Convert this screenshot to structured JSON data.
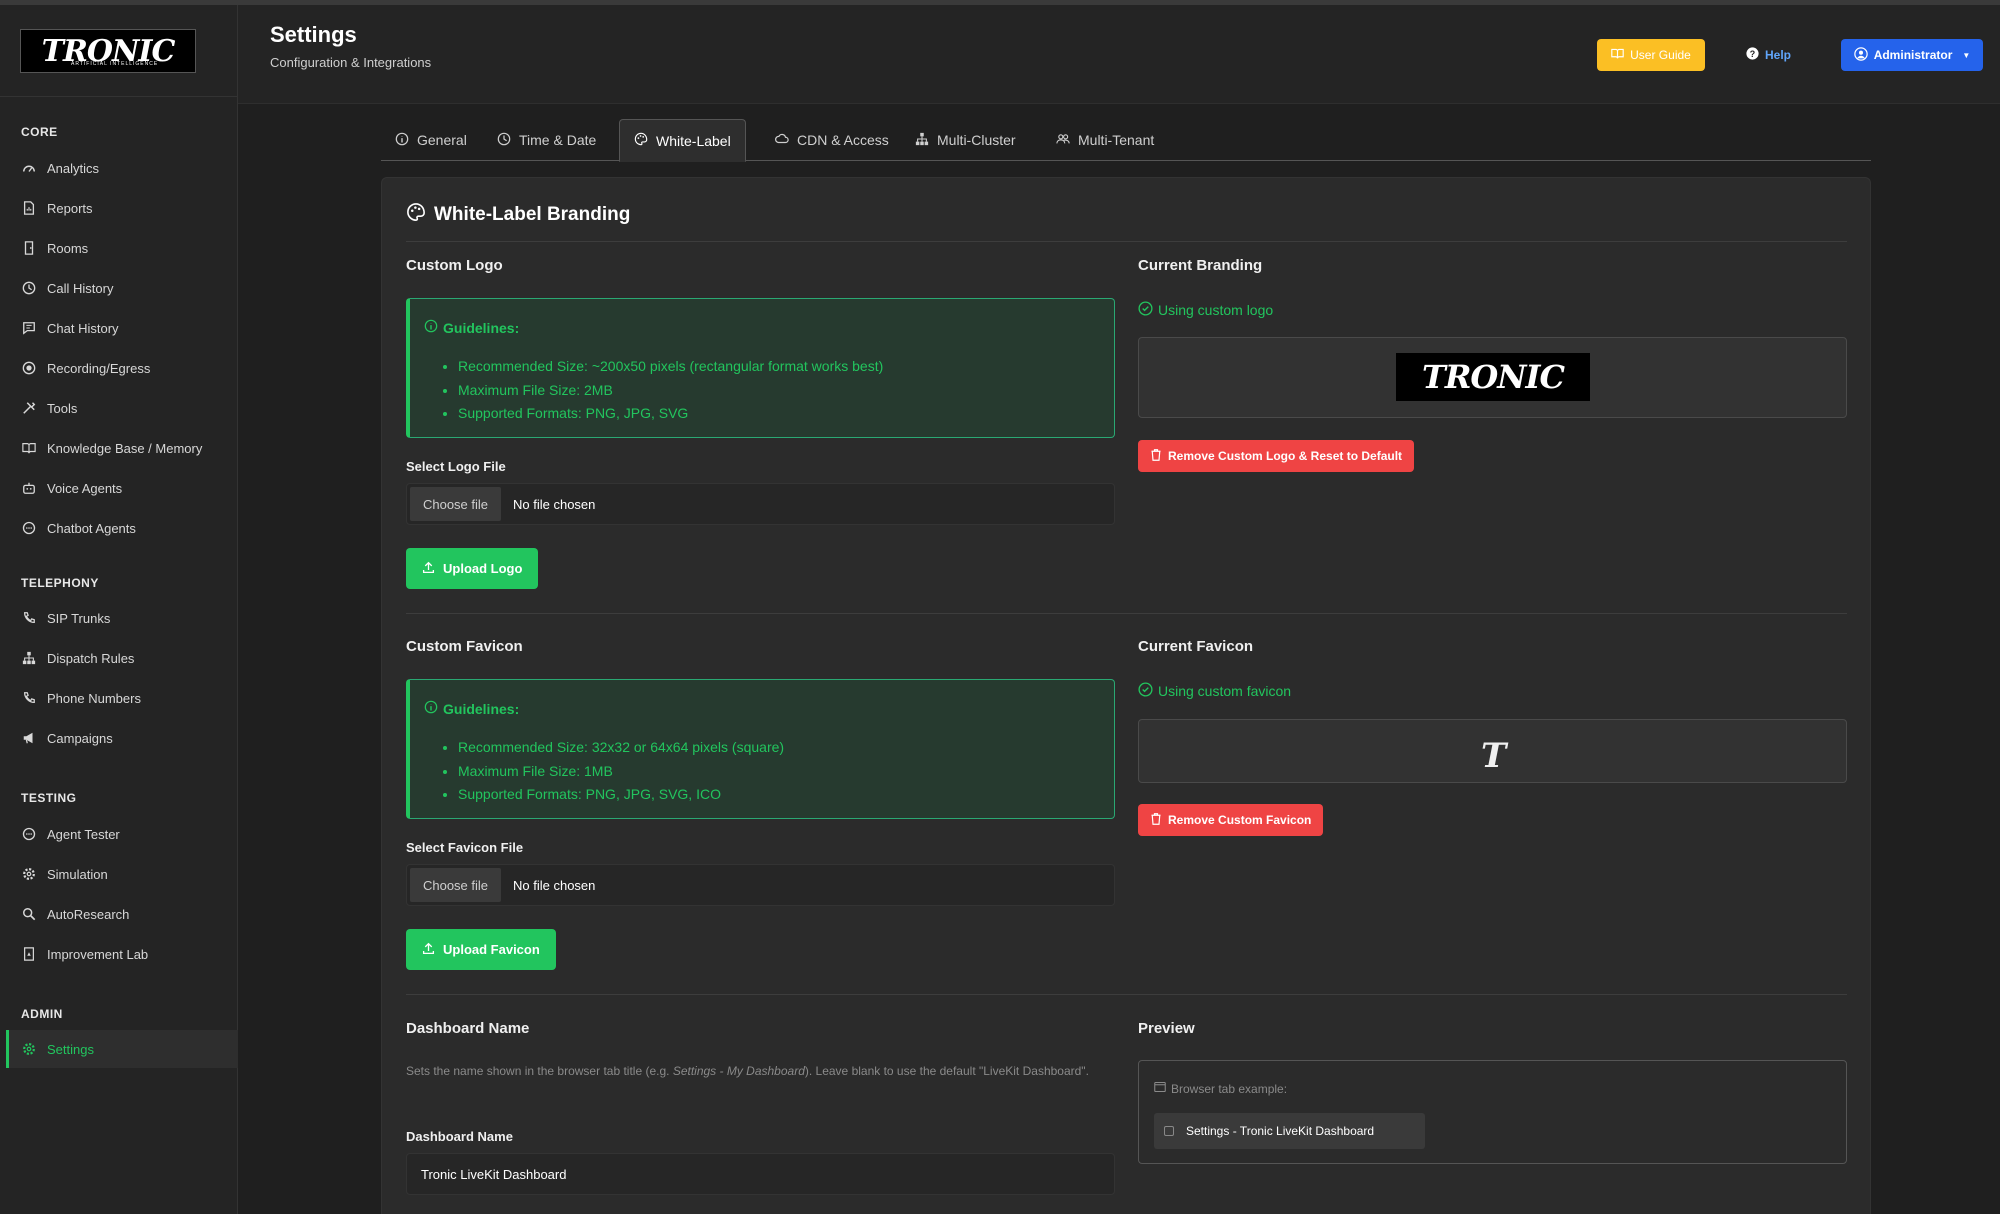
{
  "sidebar": {
    "logo": {
      "text": "TRONIC",
      "sub": "ARTIFICIAL INTELLIGENCE"
    },
    "sections": [
      {
        "label": "CORE",
        "items": [
          {
            "label": "Analytics",
            "icon": "gauge-icon"
          },
          {
            "label": "Reports",
            "icon": "report-icon"
          },
          {
            "label": "Rooms",
            "icon": "door-icon"
          },
          {
            "label": "Call History",
            "icon": "clock-icon"
          },
          {
            "label": "Chat History",
            "icon": "chat-icon"
          },
          {
            "label": "Recording/Egress",
            "icon": "record-icon"
          },
          {
            "label": "Tools",
            "icon": "tools-icon"
          },
          {
            "label": "Knowledge Base / Memory",
            "icon": "book-icon"
          },
          {
            "label": "Voice Agents",
            "icon": "robot-icon"
          },
          {
            "label": "Chatbot Agents",
            "icon": "chatbot-icon"
          }
        ]
      },
      {
        "label": "TELEPHONY",
        "items": [
          {
            "label": "SIP Trunks",
            "icon": "phone-icon"
          },
          {
            "label": "Dispatch Rules",
            "icon": "sitemap-icon"
          },
          {
            "label": "Phone Numbers",
            "icon": "phone-icon"
          },
          {
            "label": "Campaigns",
            "icon": "megaphone-icon"
          }
        ]
      },
      {
        "label": "TESTING",
        "items": [
          {
            "label": "Agent Tester",
            "icon": "chat-icon"
          },
          {
            "label": "Simulation",
            "icon": "gear-icon"
          },
          {
            "label": "AutoResearch",
            "icon": "search-icon"
          },
          {
            "label": "Improvement Lab",
            "icon": "flask-icon"
          }
        ]
      },
      {
        "label": "ADMIN",
        "items": [
          {
            "label": "Settings",
            "icon": "gear-icon",
            "active": true
          }
        ]
      }
    ]
  },
  "header": {
    "title": "Settings",
    "subtitle": "Configuration & Integrations",
    "user_guide": "User Guide",
    "help": "Help",
    "admin": "Administrator"
  },
  "tabs": [
    {
      "label": "General",
      "icon": "info-icon"
    },
    {
      "label": "Time & Date",
      "icon": "clock-icon"
    },
    {
      "label": "White-Label",
      "icon": "palette-icon",
      "active": true
    },
    {
      "label": "CDN & Access",
      "icon": "cloud-icon"
    },
    {
      "label": "Multi-Cluster",
      "icon": "sitemap-icon"
    },
    {
      "label": "Multi-Tenant",
      "icon": "users-icon"
    }
  ],
  "card": {
    "title": "White-Label Branding",
    "logo": {
      "section_title": "Custom Logo",
      "guidelines_title": "Guidelines:",
      "guidelines": [
        "Recommended Size: ~200x50 pixels (rectangular format works best)",
        "Maximum File Size: 2MB",
        "Supported Formats: PNG, JPG, SVG"
      ],
      "file_label": "Select Logo File",
      "choose_label": "Choose file",
      "no_file": "No file chosen",
      "upload_label": "Upload Logo",
      "current_title": "Current Branding",
      "status": "Using custom logo",
      "remove_label": "Remove Custom Logo & Reset to Default"
    },
    "favicon": {
      "section_title": "Custom Favicon",
      "guidelines_title": "Guidelines:",
      "guidelines": [
        "Recommended Size: 32x32 or 64x64 pixels (square)",
        "Maximum File Size: 1MB",
        "Supported Formats: PNG, JPG, SVG, ICO"
      ],
      "file_label": "Select Favicon File",
      "choose_label": "Choose file",
      "no_file": "No file chosen",
      "upload_label": "Upload Favicon",
      "current_title": "Current Favicon",
      "status": "Using custom favicon",
      "remove_label": "Remove Custom Favicon",
      "glyph": "T"
    },
    "dashboard": {
      "section_title": "Dashboard Name",
      "help_prefix": "Sets the name shown in the browser tab title (e.g. ",
      "help_example": "Settings - My Dashboard",
      "help_suffix": "). Leave blank to use the default \"LiveKit Dashboard\".",
      "field_label": "Dashboard Name",
      "value": "Tronic LiveKit Dashboard",
      "preview_title": "Preview",
      "tab_example_label": "Browser tab example:",
      "tab_example": "Settings - Tronic LiveKit Dashboard"
    }
  },
  "colors": {
    "accent_green": "#22c55e",
    "danger": "#ef4444",
    "primary": "#2563eb",
    "warning": "#fbbf24"
  }
}
